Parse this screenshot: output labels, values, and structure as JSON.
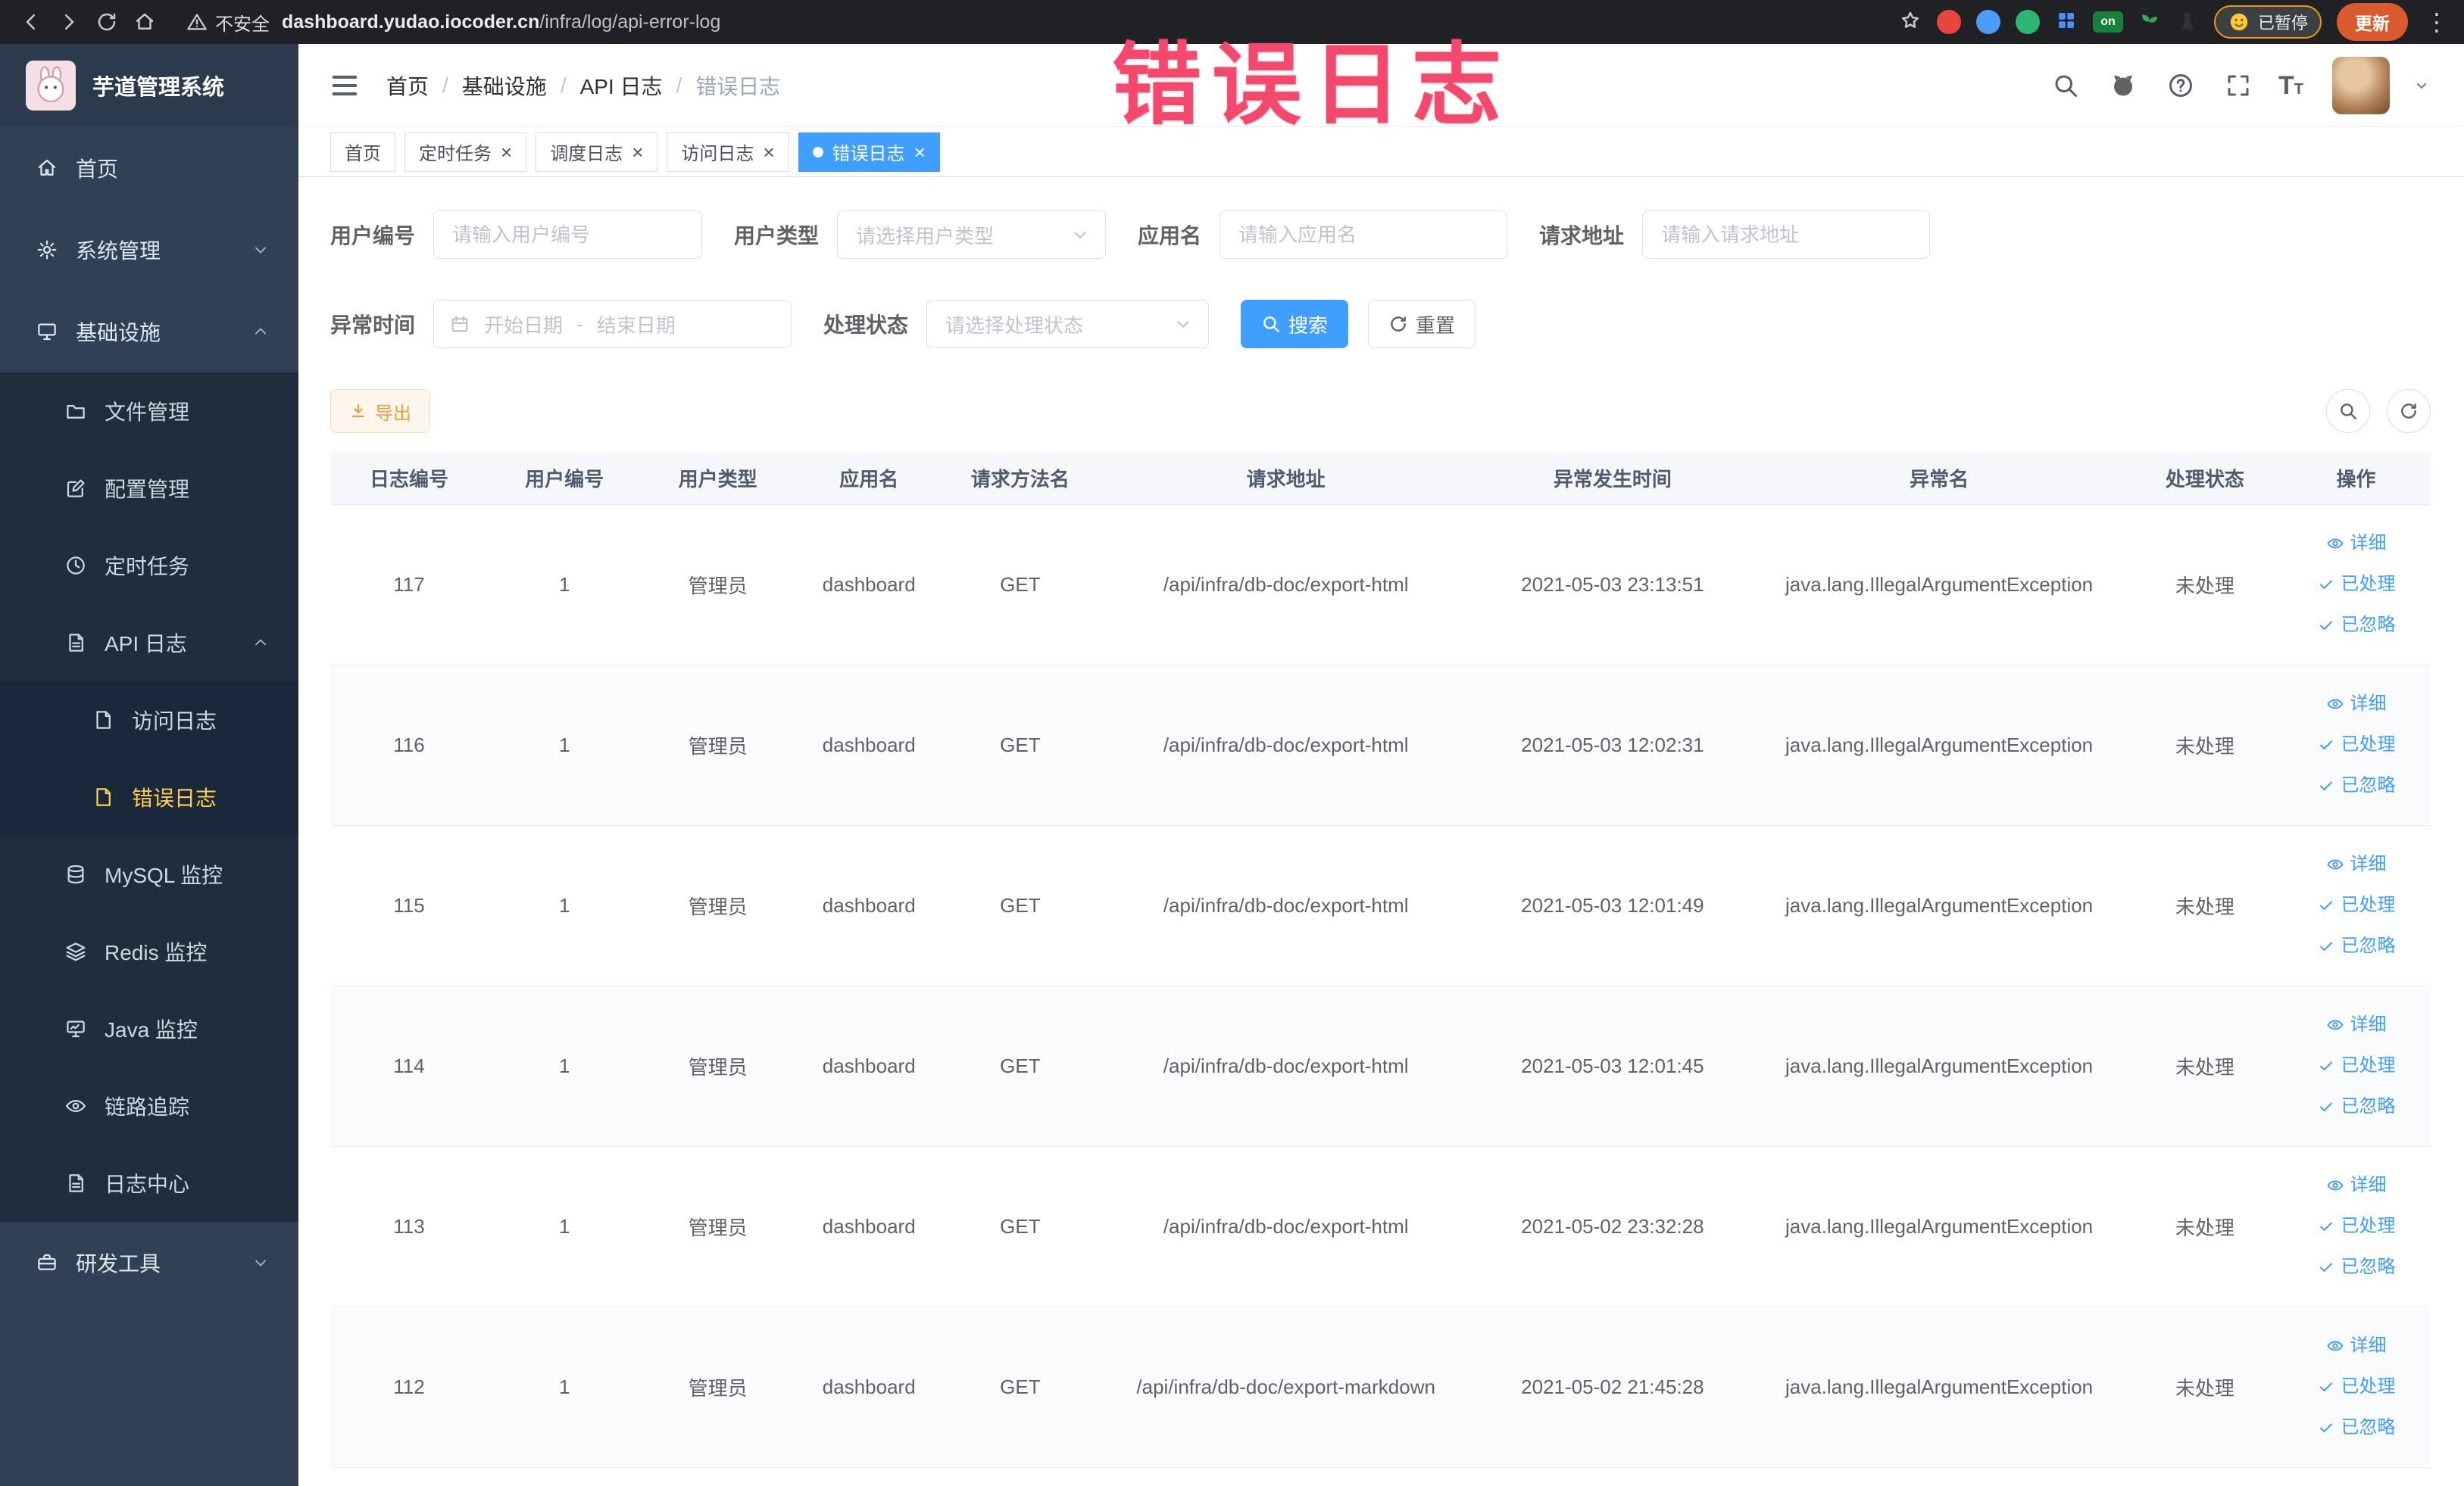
{
  "icons": {
    "close": "×",
    "kebab": "⋮",
    "help": "?",
    "crumb_sep": "/",
    "range_sep": "-",
    "font_big": "T",
    "font_small": "T"
  },
  "browser": {
    "security_label": "不安全",
    "url_domain": "dashboard.yudao.iocoder.cn",
    "url_path": "/infra/log/api-error-log",
    "extension_badge": "on",
    "paused_badge": "已暂停",
    "update_button": "更新"
  },
  "overlay": {
    "text": "错误日志"
  },
  "sidebar": {
    "logo_title": "芋道管理系统",
    "items": [
      {
        "label": "首页"
      },
      {
        "label": "系统管理"
      },
      {
        "label": "基础设施"
      },
      {
        "label": "文件管理"
      },
      {
        "label": "配置管理"
      },
      {
        "label": "定时任务"
      },
      {
        "label": "API 日志"
      },
      {
        "label": "访问日志"
      },
      {
        "label": "错误日志"
      },
      {
        "label": "MySQL 监控"
      },
      {
        "label": "Redis 监控"
      },
      {
        "label": "Java 监控"
      },
      {
        "label": "链路追踪"
      },
      {
        "label": "日志中心"
      },
      {
        "label": "研发工具"
      }
    ]
  },
  "header": {
    "breadcrumb": [
      "首页",
      "基础设施",
      "API 日志",
      "错误日志"
    ]
  },
  "tabs": [
    {
      "label": "首页"
    },
    {
      "label": "定时任务"
    },
    {
      "label": "调度日志"
    },
    {
      "label": "访问日志"
    },
    {
      "label": "错误日志"
    }
  ],
  "filters": {
    "user_id_label": "用户编号",
    "user_id_placeholder": "请输入用户编号",
    "user_type_label": "用户类型",
    "user_type_placeholder": "请选择用户类型",
    "app_name_label": "应用名",
    "app_name_placeholder": "请输入应用名",
    "request_url_label": "请求地址",
    "request_url_placeholder": "请输入请求地址",
    "exception_time_label": "异常时间",
    "start_date_placeholder": "开始日期",
    "end_date_placeholder": "结束日期",
    "process_status_label": "处理状态",
    "process_status_placeholder": "请选择处理状态",
    "search_button": "搜索",
    "reset_button": "重置"
  },
  "toolbar": {
    "export_button": "导出"
  },
  "table": {
    "columns": [
      "日志编号",
      "用户编号",
      "用户类型",
      "应用名",
      "请求方法名",
      "请求地址",
      "异常发生时间",
      "异常名",
      "处理状态",
      "操作"
    ],
    "actions": {
      "detail": "详细",
      "processed": "已处理",
      "ignored": "已忽略"
    },
    "rows": [
      {
        "id": "117",
        "user_id": "1",
        "user_type": "管理员",
        "app_name": "dashboard",
        "method": "GET",
        "url": "/api/infra/db-doc/export-html",
        "time": "2021-05-03 23:13:51",
        "exception": "java.lang.IllegalArgumentException",
        "status": "未处理"
      },
      {
        "id": "116",
        "user_id": "1",
        "user_type": "管理员",
        "app_name": "dashboard",
        "method": "GET",
        "url": "/api/infra/db-doc/export-html",
        "time": "2021-05-03 12:02:31",
        "exception": "java.lang.IllegalArgumentException",
        "status": "未处理"
      },
      {
        "id": "115",
        "user_id": "1",
        "user_type": "管理员",
        "app_name": "dashboard",
        "method": "GET",
        "url": "/api/infra/db-doc/export-html",
        "time": "2021-05-03 12:01:49",
        "exception": "java.lang.IllegalArgumentException",
        "status": "未处理"
      },
      {
        "id": "114",
        "user_id": "1",
        "user_type": "管理员",
        "app_name": "dashboard",
        "method": "GET",
        "url": "/api/infra/db-doc/export-html",
        "time": "2021-05-03 12:01:45",
        "exception": "java.lang.IllegalArgumentException",
        "status": "未处理"
      },
      {
        "id": "113",
        "user_id": "1",
        "user_type": "管理员",
        "app_name": "dashboard",
        "method": "GET",
        "url": "/api/infra/db-doc/export-html",
        "time": "2021-05-02 23:32:28",
        "exception": "java.lang.IllegalArgumentException",
        "status": "未处理"
      },
      {
        "id": "112",
        "user_id": "1",
        "user_type": "管理员",
        "app_name": "dashboard",
        "method": "GET",
        "url": "/api/infra/db-doc/export-markdown",
        "time": "2021-05-02 21:45:28",
        "exception": "java.lang.IllegalArgumentException",
        "status": "未处理"
      }
    ]
  }
}
